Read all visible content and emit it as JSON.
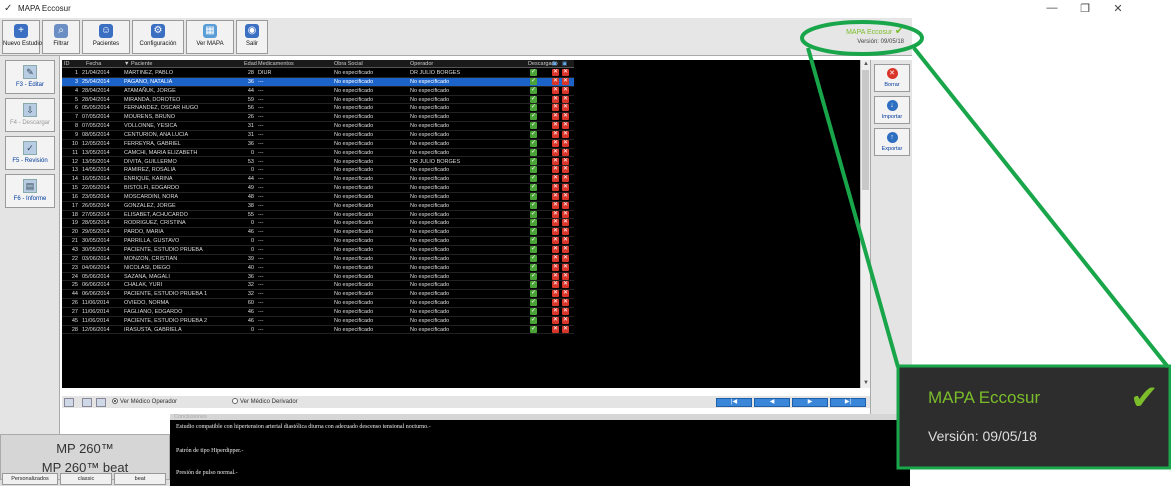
{
  "window": {
    "title": "MAPA Eccosur",
    "minimize": "—",
    "maximize": "❐",
    "close": "✕"
  },
  "toolbar": [
    {
      "label": "Nuevo Estudio",
      "icon": "new-study-icon",
      "glyph": "+",
      "color": "#3a6fc2"
    },
    {
      "label": "Filtrar",
      "icon": "filter-icon",
      "glyph": "⌕",
      "color": "#6b8fc4"
    },
    {
      "label": "Pacientes",
      "icon": "patients-icon",
      "glyph": "☺",
      "color": "#3a6fc2"
    },
    {
      "label": "Configuración",
      "icon": "settings-icon",
      "glyph": "⚙",
      "color": "#3a6fc2"
    },
    {
      "label": "Ver MAPA",
      "icon": "view-map-icon",
      "glyph": "▦",
      "color": "#5a9ed8"
    },
    {
      "label": "Salir",
      "icon": "exit-icon",
      "glyph": "◉",
      "color": "#3a6fc2"
    }
  ],
  "brand": {
    "name": "MAPA Eccosur",
    "version": "Versión: 09/05/18"
  },
  "left_panel": [
    {
      "label": "F3 - Editar",
      "icon": "edit-icon",
      "glyph": "✎",
      "disabled": false
    },
    {
      "label": "F4 - Descargar",
      "icon": "download-icon",
      "glyph": "⇩",
      "disabled": true
    },
    {
      "label": "F5 - Revisión",
      "icon": "review-icon",
      "glyph": "✓",
      "disabled": false
    },
    {
      "label": "F6 - Informe",
      "icon": "report-icon",
      "glyph": "▤",
      "disabled": false
    }
  ],
  "right_panel": [
    {
      "label": "Borrar",
      "icon": "delete-icon",
      "glyph": "✕",
      "color": "#d9352b"
    },
    {
      "label": "Importar",
      "icon": "import-icon",
      "glyph": "↓",
      "color": "#2f6fc1"
    },
    {
      "label": "Exportar",
      "icon": "export-icon",
      "glyph": "↑",
      "color": "#2f6fc1"
    }
  ],
  "table": {
    "columns": [
      "ID",
      "Fecha",
      "▼ Paciente",
      "Edad",
      "Medicamentos",
      "Obra Social",
      "Operador",
      "Descargado"
    ],
    "rows": [
      {
        "id": "1",
        "fecha": "21/04/2014",
        "paciente": "MARTINEZ, PABLO",
        "edad": "28",
        "med": "DIUR",
        "os": "No especificado",
        "op": "DR JULIO BORGES",
        "sel": false
      },
      {
        "id": "3",
        "fecha": "25/04/2014",
        "paciente": "PAGANO, NATALIA",
        "edad": "36",
        "med": "---",
        "os": "No especificado",
        "op": "No especificado",
        "sel": true
      },
      {
        "id": "4",
        "fecha": "28/04/2014",
        "paciente": "ATAMAÑUK, JORGE",
        "edad": "44",
        "med": "---",
        "os": "No especificado",
        "op": "No especificado",
        "sel": false
      },
      {
        "id": "5",
        "fecha": "28/04/2014",
        "paciente": "MIRANDA, DOROTEO",
        "edad": "59",
        "med": "---",
        "os": "No especificado",
        "op": "No especificado",
        "sel": false
      },
      {
        "id": "6",
        "fecha": "05/05/2014",
        "paciente": "FERNANDEZ, OSCAR HUGO",
        "edad": "56",
        "med": "---",
        "os": "No especificado",
        "op": "No especificado",
        "sel": false
      },
      {
        "id": "7",
        "fecha": "07/05/2014",
        "paciente": "MOURENS, BRUNO",
        "edad": "26",
        "med": "---",
        "os": "No especificado",
        "op": "No especificado",
        "sel": false
      },
      {
        "id": "8",
        "fecha": "07/05/2014",
        "paciente": "VOLLONNE, YESICA",
        "edad": "31",
        "med": "---",
        "os": "No especificado",
        "op": "No especificado",
        "sel": false
      },
      {
        "id": "9",
        "fecha": "08/05/2014",
        "paciente": "CENTURION, ANA LUCIA",
        "edad": "31",
        "med": "---",
        "os": "No especificado",
        "op": "No especificado",
        "sel": false
      },
      {
        "id": "10",
        "fecha": "12/05/2014",
        "paciente": "FERREYRA, GABRIEL",
        "edad": "36",
        "med": "---",
        "os": "No especificado",
        "op": "No especificado",
        "sel": false
      },
      {
        "id": "11",
        "fecha": "13/05/2014",
        "paciente": "CAMCHI, MARIA ELIZABETH",
        "edad": "0",
        "med": "---",
        "os": "No especificado",
        "op": "No especificado",
        "sel": false
      },
      {
        "id": "12",
        "fecha": "13/05/2014",
        "paciente": "DIVITA, GUILLERMO",
        "edad": "53",
        "med": "---",
        "os": "No especificado",
        "op": "DR JULIO BORGES",
        "sel": false
      },
      {
        "id": "13",
        "fecha": "14/05/2014",
        "paciente": "RAMIREZ, ROSALIA",
        "edad": "0",
        "med": "---",
        "os": "No especificado",
        "op": "No especificado",
        "sel": false
      },
      {
        "id": "14",
        "fecha": "16/05/2014",
        "paciente": "ENRIQUE, KARINA",
        "edad": "44",
        "med": "---",
        "os": "No especificado",
        "op": "No especificado",
        "sel": false
      },
      {
        "id": "15",
        "fecha": "22/05/2014",
        "paciente": "BISTOLFI, EDGARDO",
        "edad": "49",
        "med": "---",
        "os": "No especificado",
        "op": "No especificado",
        "sel": false
      },
      {
        "id": "16",
        "fecha": "23/05/2014",
        "paciente": "MOSCARDINI, NORA",
        "edad": "48",
        "med": "---",
        "os": "No especificado",
        "op": "No especificado",
        "sel": false
      },
      {
        "id": "17",
        "fecha": "26/05/2014",
        "paciente": "GONZALEZ, JORGE",
        "edad": "38",
        "med": "---",
        "os": "No especificado",
        "op": "No especificado",
        "sel": false
      },
      {
        "id": "18",
        "fecha": "27/05/2014",
        "paciente": "ELISABET, ACHUCARDO",
        "edad": "55",
        "med": "---",
        "os": "No especificado",
        "op": "No especificado",
        "sel": false
      },
      {
        "id": "19",
        "fecha": "28/05/2014",
        "paciente": "RODRIGUEZ, CRISTINA",
        "edad": "0",
        "med": "---",
        "os": "No especificado",
        "op": "No especificado",
        "sel": false
      },
      {
        "id": "20",
        "fecha": "29/05/2014",
        "paciente": "PARDO, MARIA",
        "edad": "46",
        "med": "---",
        "os": "No especificado",
        "op": "No especificado",
        "sel": false
      },
      {
        "id": "21",
        "fecha": "30/05/2014",
        "paciente": "PARRILLA, GUSTAVO",
        "edad": "0",
        "med": "---",
        "os": "No especificado",
        "op": "No especificado",
        "sel": false
      },
      {
        "id": "43",
        "fecha": "30/05/2014",
        "paciente": "PACIENTE, ESTUDIO PRUEBA",
        "edad": "0",
        "med": "---",
        "os": "No especificado",
        "op": "No especificado",
        "sel": false
      },
      {
        "id": "22",
        "fecha": "03/06/2014",
        "paciente": "MONZON, CRISTIAN",
        "edad": "39",
        "med": "---",
        "os": "No especificado",
        "op": "No especificado",
        "sel": false
      },
      {
        "id": "23",
        "fecha": "04/06/2014",
        "paciente": "NICOLASI, DIEGO",
        "edad": "40",
        "med": "---",
        "os": "No especificado",
        "op": "No especificado",
        "sel": false
      },
      {
        "id": "24",
        "fecha": "05/06/2014",
        "paciente": "SAZANA, MAGALI",
        "edad": "36",
        "med": "---",
        "os": "No especificado",
        "op": "No especificado",
        "sel": false
      },
      {
        "id": "25",
        "fecha": "06/06/2014",
        "paciente": "CHALAK, YURI",
        "edad": "32",
        "med": "---",
        "os": "No especificado",
        "op": "No especificado",
        "sel": false
      },
      {
        "id": "44",
        "fecha": "06/06/2014",
        "paciente": "PACIENTE, ESTUDIO PRUEBA 1",
        "edad": "32",
        "med": "---",
        "os": "No especificado",
        "op": "No especificado",
        "sel": false
      },
      {
        "id": "26",
        "fecha": "11/06/2014",
        "paciente": "OVIEDO, NORMA",
        "edad": "60",
        "med": "---",
        "os": "No especificado",
        "op": "No especificado",
        "sel": false
      },
      {
        "id": "27",
        "fecha": "11/06/2014",
        "paciente": "FAGLIANO, EDGARDO",
        "edad": "46",
        "med": "---",
        "os": "No especificado",
        "op": "No especificado",
        "sel": false
      },
      {
        "id": "45",
        "fecha": "11/06/2014",
        "paciente": "PACIENTE, ESTUDIO PRUEBA 2",
        "edad": "46",
        "med": "---",
        "os": "No especificado",
        "op": "No especificado",
        "sel": false
      },
      {
        "id": "28",
        "fecha": "12/06/2014",
        "paciente": "IRASUSTA, GABRIELA",
        "edad": "0",
        "med": "---",
        "os": "No especificado",
        "op": "No especificado",
        "sel": false
      }
    ]
  },
  "nav": {
    "radio_operador": "Ver Médico Operador",
    "radio_derivador": "Ver Médico Derivador",
    "first": "|◀",
    "prev": "◀",
    "next": "▶",
    "last": "▶|"
  },
  "bottom": {
    "device1": "MP 260™",
    "device2": "MP 260™ beat",
    "colores_title": "Colores",
    "color_buttons": [
      "Personalizados",
      "classic",
      "beat"
    ],
    "conclusiones_title": "Conclusiones",
    "conclusiones": [
      "Estudio compatible con hipertension arterial diastólica diurna con adecuado descenso tensional nocturno.-",
      "Patrón de tipo Hiperdipper.-",
      "Presión de pulso normal.-"
    ]
  },
  "zoom": {
    "name": "MAPA Eccosur",
    "version": "Versión: 09/05/18"
  },
  "colors": {
    "brand_green": "#7bbd2a",
    "selection_blue": "#1c63c9",
    "callout_green": "#19a64a"
  }
}
